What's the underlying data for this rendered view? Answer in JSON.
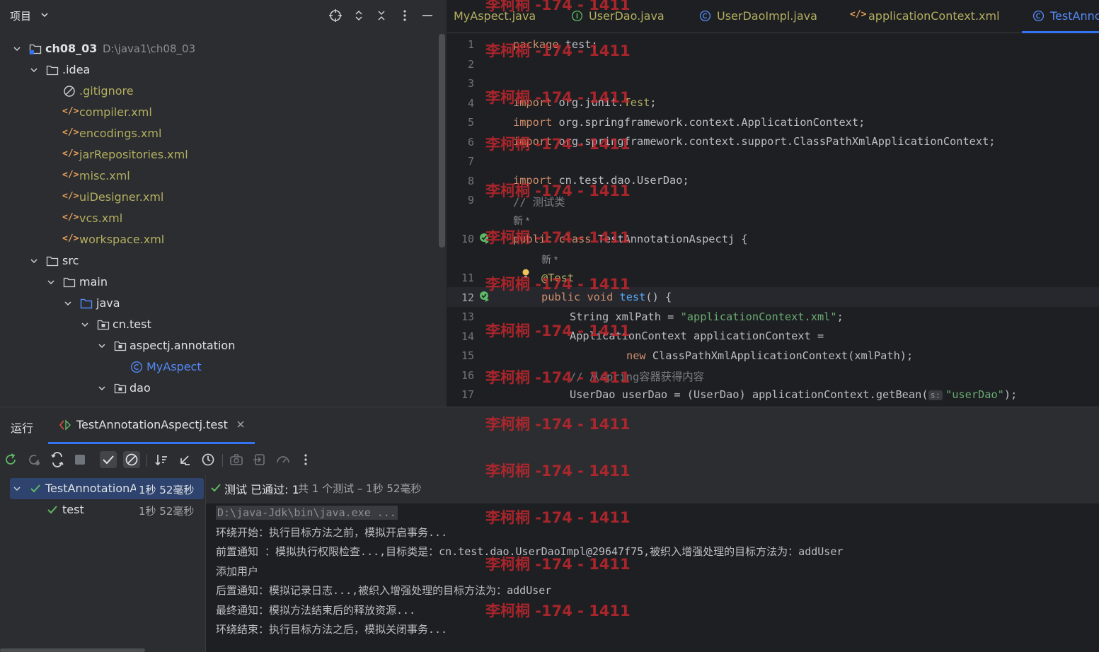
{
  "project": {
    "title": "项目",
    "tree": [
      {
        "label": "ch08_03",
        "sub": "D:\\java1\\ch08_03",
        "type": "module",
        "depth": 0,
        "expanded": true
      },
      {
        "label": ".idea",
        "type": "folder",
        "depth": 1,
        "expanded": true
      },
      {
        "label": ".gitignore",
        "type": "ignore",
        "depth": 2
      },
      {
        "label": "compiler.xml",
        "type": "xml",
        "depth": 2
      },
      {
        "label": "encodings.xml",
        "type": "xml",
        "depth": 2
      },
      {
        "label": "jarRepositories.xml",
        "type": "xml",
        "depth": 2
      },
      {
        "label": "misc.xml",
        "type": "xml",
        "depth": 2
      },
      {
        "label": "uiDesigner.xml",
        "type": "xml",
        "depth": 2
      },
      {
        "label": "vcs.xml",
        "type": "xml",
        "depth": 2
      },
      {
        "label": "workspace.xml",
        "type": "xml",
        "depth": 2
      },
      {
        "label": "src",
        "type": "folder",
        "depth": 1,
        "expanded": true
      },
      {
        "label": "main",
        "type": "folder",
        "depth": 2,
        "expanded": true
      },
      {
        "label": "java",
        "type": "source-folder",
        "depth": 3,
        "expanded": true
      },
      {
        "label": "cn.test",
        "type": "package",
        "depth": 4,
        "expanded": true
      },
      {
        "label": "aspectj.annotation",
        "type": "package",
        "depth": 5,
        "expanded": true
      },
      {
        "label": "MyAspect",
        "type": "class",
        "depth": 6
      },
      {
        "label": "dao",
        "type": "package",
        "depth": 5,
        "expanded": true
      }
    ]
  },
  "editor": {
    "tabs": [
      {
        "label": "MyAspect.java",
        "icon": "class-icon"
      },
      {
        "label": "UserDao.java",
        "icon": "interface-icon"
      },
      {
        "label": "UserDaoImpl.java",
        "icon": "class-icon"
      },
      {
        "label": "applicationContext.xml",
        "icon": "xml-icon"
      },
      {
        "label": "TestAnnc",
        "icon": "class-icon",
        "active": true
      }
    ],
    "inlay_new": "新 *",
    "current_line": 12,
    "lines": [
      {
        "n": "1",
        "text": "package test;"
      },
      {
        "n": "2",
        "text": ""
      },
      {
        "n": "3",
        "text": ""
      },
      {
        "n": "4",
        "text": "import org.junit.Test;"
      },
      {
        "n": "5",
        "text": "import org.springframework.context.ApplicationContext;"
      },
      {
        "n": "6",
        "text": "import org.springframework.context.support.ClassPathXmlApplicationContext;"
      },
      {
        "n": "7",
        "text": ""
      },
      {
        "n": "8",
        "text": "import cn.test.dao.UserDao;"
      },
      {
        "n": "9",
        "text": "// 测试类"
      },
      {
        "n": "10",
        "text": "public class TestAnnotationAspectj {"
      },
      {
        "n": "11",
        "text": "@Test"
      },
      {
        "n": "12",
        "text": "public void test() {"
      },
      {
        "n": "13",
        "text": "String xmlPath = \"applicationContext.xml\";"
      },
      {
        "n": "14",
        "text": "ApplicationContext applicationContext ="
      },
      {
        "n": "15",
        "text": "new ClassPathXmlApplicationContext(xmlPath);"
      },
      {
        "n": "16",
        "text": "// 从spring容器获得内容"
      },
      {
        "n": "17",
        "text": "UserDao userDao = (UserDao) applicationContext.getBean(\"userDao\");"
      }
    ],
    "param_hint": "s:"
  },
  "run": {
    "label": "运行",
    "tab_label": "TestAnnotationAspectj.test",
    "tests": [
      {
        "name": "TestAnnotationA",
        "time": "1秒 52毫秒",
        "expanded": true
      },
      {
        "name": "test",
        "time": "1秒 52毫秒"
      }
    ],
    "status_label": "测试 已通过: 1",
    "status_detail": "共 1 个测试 – 1秒 52毫秒",
    "output": [
      "D:\\java-Jdk\\bin\\java.exe ...",
      "环绕开始：执行目标方法之前，模拟开启事务...",
      "前置通知 ：模拟执行权限检查...,目标类是：cn.test.dao.UserDaoImpl@29647f75,被织入增强处理的目标方法为：addUser",
      "添加用户",
      "后置通知：模拟记录日志...,被织入增强处理的目标方法为：addUser",
      "最终通知：模拟方法结束后的释放资源...",
      "环绕结束：执行目标方法之后，模拟关闭事务..."
    ]
  },
  "watermark": "李柯桐 -174 - 1411",
  "colors": {
    "accent": "#3574f0",
    "pass": "#5fb865",
    "xml": "#e8a15a",
    "vcs_modified": "#b3ae60",
    "class_icon": "#548af7"
  }
}
